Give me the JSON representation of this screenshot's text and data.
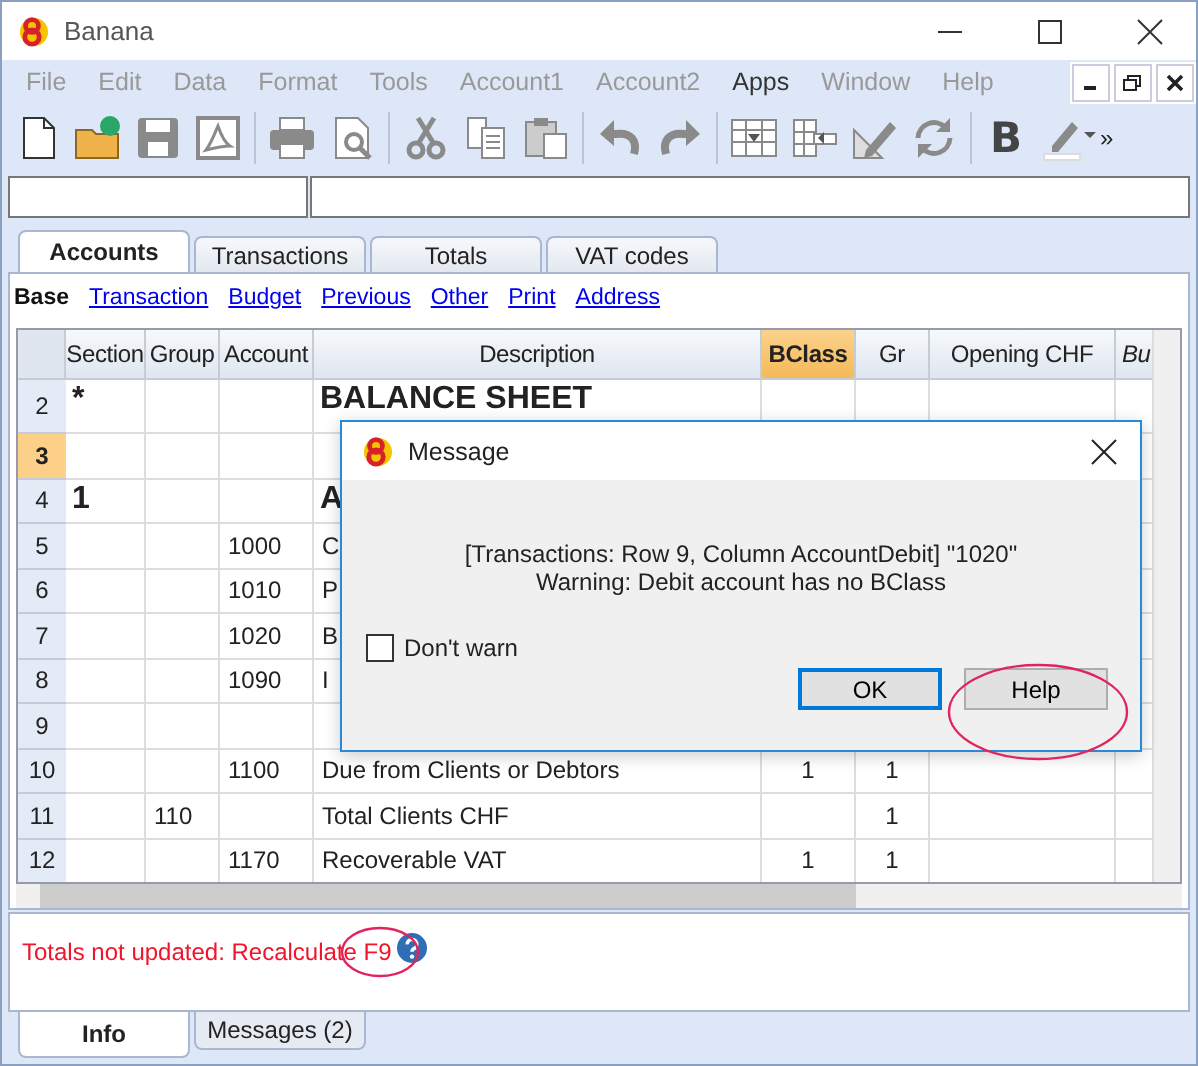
{
  "window": {
    "title": "Banana"
  },
  "menu": [
    {
      "label": "File",
      "disabled": true
    },
    {
      "label": "Edit",
      "disabled": true
    },
    {
      "label": "Data",
      "disabled": true
    },
    {
      "label": "Format",
      "disabled": true
    },
    {
      "label": "Tools",
      "disabled": true
    },
    {
      "label": "Account1",
      "disabled": true
    },
    {
      "label": "Account2",
      "disabled": true
    },
    {
      "label": "Apps",
      "disabled": false
    },
    {
      "label": "Window",
      "disabled": true
    },
    {
      "label": "Help",
      "disabled": true
    }
  ],
  "toolbar": {
    "bold_label": "B",
    "overflow": "»"
  },
  "tabs": [
    {
      "label": "Accounts",
      "selected": true
    },
    {
      "label": "Transactions",
      "selected": false
    },
    {
      "label": "Totals",
      "selected": false
    },
    {
      "label": "VAT codes",
      "selected": false
    }
  ],
  "views": [
    {
      "label": "Base",
      "selected": true
    },
    {
      "label": "Transaction",
      "selected": false
    },
    {
      "label": "Budget",
      "selected": false
    },
    {
      "label": "Previous",
      "selected": false
    },
    {
      "label": "Other",
      "selected": false
    },
    {
      "label": "Print",
      "selected": false
    },
    {
      "label": "Address",
      "selected": false
    }
  ],
  "table": {
    "columns": [
      {
        "label": "Section",
        "selected": false
      },
      {
        "label": "Group",
        "selected": false
      },
      {
        "label": "Account",
        "selected": false
      },
      {
        "label": "Description",
        "selected": false
      },
      {
        "label": "BClass",
        "selected": true
      },
      {
        "label": "Gr",
        "selected": false
      },
      {
        "label": "Opening CHF",
        "selected": false
      },
      {
        "label": "Bu",
        "selected": false
      }
    ],
    "rows": [
      {
        "number": "2",
        "kind": "heading",
        "selected": false,
        "cells": [
          "*",
          "",
          "",
          "BALANCE SHEET",
          "",
          "",
          "",
          ""
        ]
      },
      {
        "number": "3",
        "kind": "normal",
        "selected": true,
        "cells": [
          "",
          "",
          "",
          "",
          "",
          "",
          "",
          ""
        ]
      },
      {
        "number": "4",
        "kind": "heading",
        "selected": false,
        "cells": [
          "1",
          "",
          "",
          "A",
          "",
          "",
          "",
          ""
        ]
      },
      {
        "number": "5",
        "kind": "normal",
        "selected": false,
        "cells": [
          "",
          "",
          "1000",
          "C",
          "",
          "",
          "",
          ""
        ]
      },
      {
        "number": "6",
        "kind": "normal",
        "selected": false,
        "cells": [
          "",
          "",
          "1010",
          "P",
          "",
          "",
          "",
          ""
        ]
      },
      {
        "number": "7",
        "kind": "normal",
        "selected": false,
        "cells": [
          "",
          "",
          "1020",
          "B",
          "",
          "",
          "",
          ""
        ]
      },
      {
        "number": "8",
        "kind": "normal",
        "selected": false,
        "cells": [
          "",
          "",
          "1090",
          "I",
          "",
          "",
          "",
          ""
        ]
      },
      {
        "number": "9",
        "kind": "normal",
        "selected": false,
        "cells": [
          "",
          "",
          "",
          "",
          "",
          "",
          "",
          ""
        ]
      },
      {
        "number": "10",
        "kind": "normal",
        "selected": false,
        "cells": [
          "",
          "",
          "1100",
          "Due from Clients or Debtors",
          "1",
          "1",
          "",
          ""
        ]
      },
      {
        "number": "11",
        "kind": "normal",
        "selected": false,
        "cells": [
          "",
          "110",
          "",
          "Total Clients CHF",
          "",
          "1",
          "",
          ""
        ]
      },
      {
        "number": "12",
        "kind": "normal",
        "selected": false,
        "cells": [
          "",
          "",
          "1170",
          "Recoverable VAT",
          "1",
          "1",
          "",
          ""
        ]
      }
    ]
  },
  "info": {
    "message": "Totals not updated: Recalculate F9"
  },
  "bottom_tabs": [
    {
      "label": "Info",
      "selected": true
    },
    {
      "label": "Messages (2)",
      "selected": false
    }
  ],
  "dialog": {
    "title": "Message",
    "lines": [
      "[Transactions: Row 9, Column AccountDebit] \"1020\"",
      "Warning: Debit account has no BClass"
    ],
    "checkbox": {
      "label": "Don't warn",
      "checked": false
    },
    "buttons": [
      {
        "label": "OK",
        "default": true
      },
      {
        "label": "Help",
        "default": false
      }
    ]
  }
}
